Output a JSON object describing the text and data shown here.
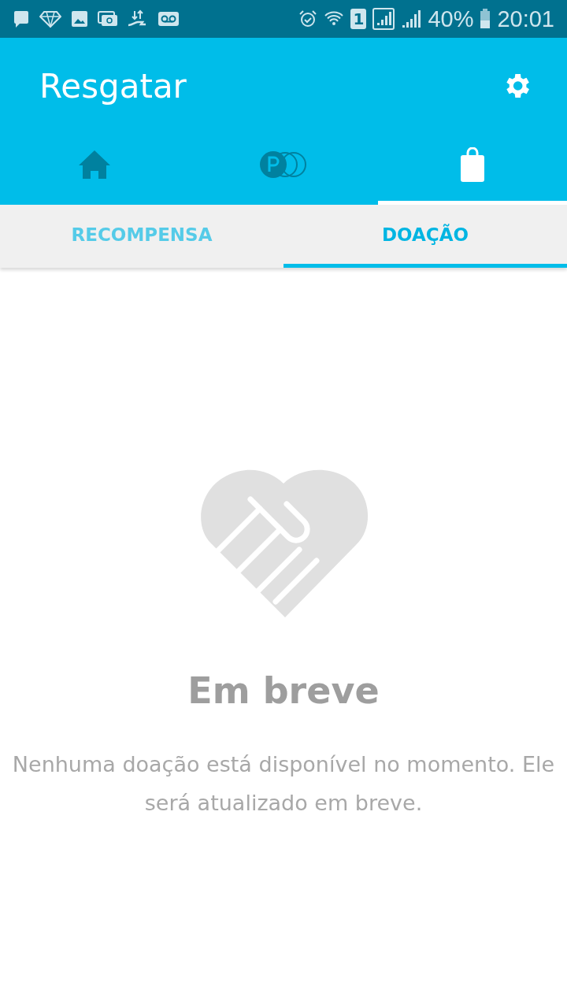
{
  "status_bar": {
    "sim": "1",
    "battery": "40%",
    "time": "20:01"
  },
  "header": {
    "title": "Resgatar"
  },
  "icon_tabs": [
    {
      "kind": "home",
      "selected": false
    },
    {
      "kind": "points",
      "selected": false
    },
    {
      "kind": "bag",
      "selected": true
    }
  ],
  "sub_tabs": [
    {
      "label": "RECOMPENSA",
      "selected": false
    },
    {
      "label": "DOAÇÃO",
      "selected": true
    }
  ],
  "empty_state": {
    "title": "Em breve",
    "message": "Nenhuma doação está disponível no momento. Ele será atualizado em breve."
  }
}
